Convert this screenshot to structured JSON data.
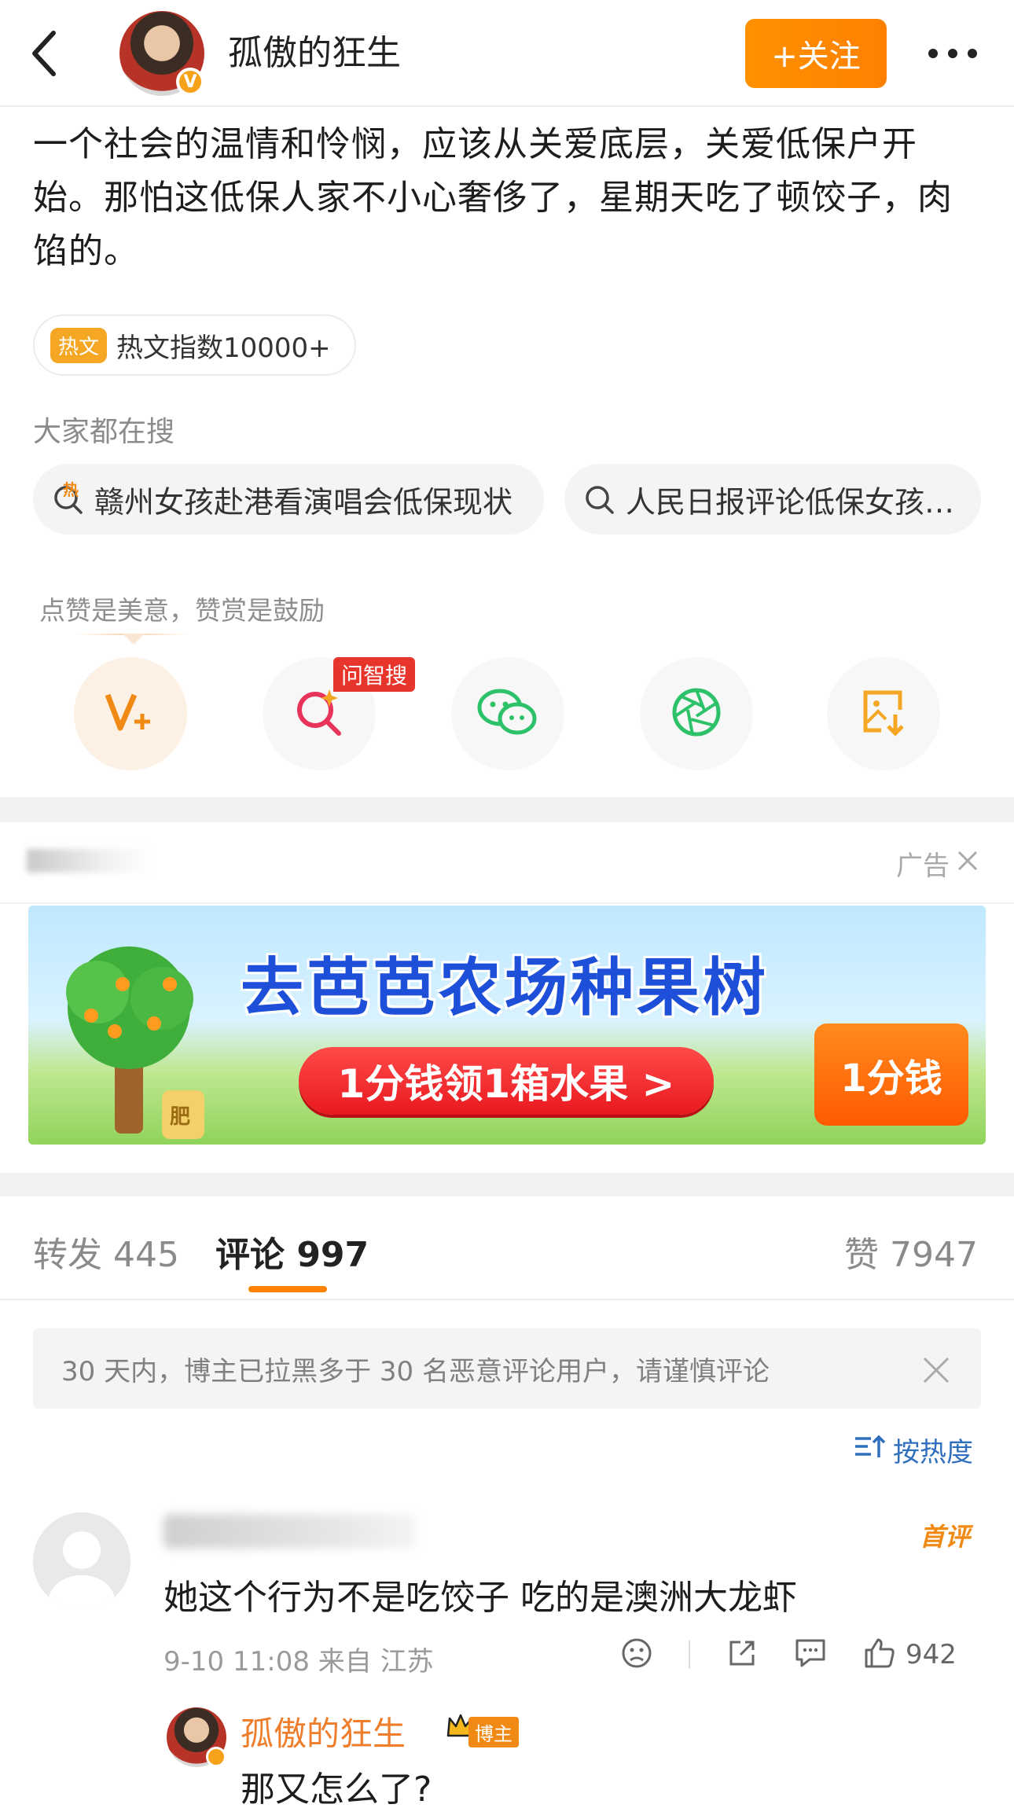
{
  "header": {
    "username": "孤傲的狂生",
    "follow_label": "+关注"
  },
  "post": {
    "text": "一个社会的温情和怜悯，应该从关爱底层，关爱低保户开始。那怕这低保人家不小心奢侈了，星期天吃了顿饺子，肉馅的。",
    "hot_tag": "热文",
    "hot_index": "热文指数10000+"
  },
  "search": {
    "label": "大家都在搜",
    "chips": [
      {
        "text": "赣州女孩赴港看演唱会低保现状",
        "hot_mark": "热"
      },
      {
        "text": "人民日报评论低保女孩…"
      }
    ]
  },
  "encourage_text": "点赞是美意，赞赏是鼓励",
  "actions": {
    "zhisou_badge": "问智搜"
  },
  "ad": {
    "label": "广告",
    "banner_title": "去芭芭农场种果树",
    "banner_cta": "1分钱领1箱水果 >",
    "banner_price": "1分钱",
    "fertilizer_label": "肥"
  },
  "tabs": {
    "repost_label": "转发 445",
    "comment_label": "评论 997",
    "like_label": "赞 7947"
  },
  "notice": {
    "text": "30 天内，博主已拉黑多于 30 名恶意评论用户，请谨慎评论"
  },
  "sort": {
    "label": "按热度"
  },
  "comment": {
    "first_badge": "首评",
    "text": "她这个行为不是吃饺子 吃的是澳洲大龙虾",
    "meta": "9-10 11:08  来自 江苏",
    "likes": "942",
    "reply": {
      "name": "孤傲的狂生",
      "badge": "博主",
      "text": "那又怎么了?"
    }
  },
  "colors": {
    "accent": "#ff8200",
    "link": "#2f6fbd",
    "ad_red": "#e8191f"
  }
}
